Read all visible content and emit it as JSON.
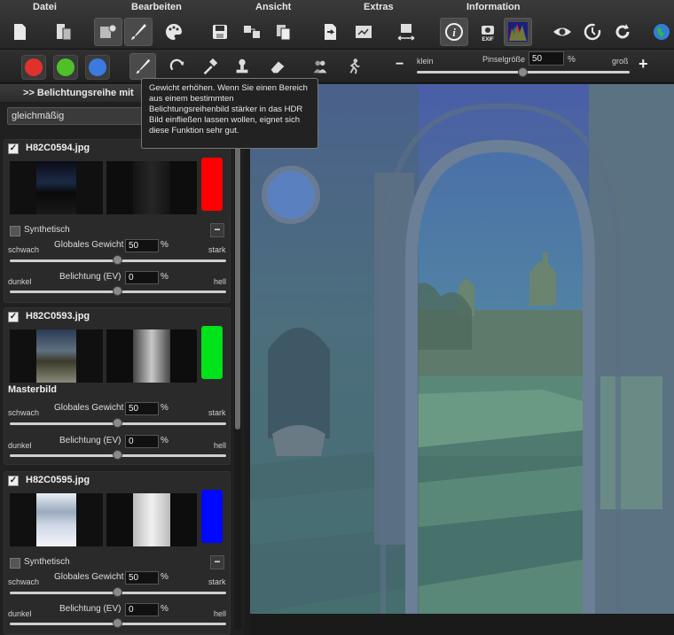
{
  "menu": {
    "datei": "Datei",
    "bearbeiten": "Bearbeiten",
    "ansicht": "Ansicht",
    "extras": "Extras",
    "information": "Information"
  },
  "toolbar_icons": [
    "new-document-icon",
    "open-document-icon",
    "settings-icon",
    "brush-icon",
    "palette-icon",
    "save-icon",
    "export-icon",
    "copy-icon",
    "send-icon",
    "batch-icon",
    "transform-icon",
    "info-icon",
    "exif-icon",
    "histogram-icon",
    "eye-icon",
    "history-icon",
    "redo-icon",
    "globe-icon"
  ],
  "exif_label": "EXIF",
  "colors": {
    "red": "#e0312d",
    "green": "#4ec12a",
    "blue": "#3b7be0",
    "accent_red": "#ff0000",
    "accent_green": "#00e21a",
    "accent_blue": "#0008ff"
  },
  "brush": {
    "klein": "klein",
    "size_label": "Pinselgröße",
    "size_value": "50",
    "percent": "%",
    "gross": "groß",
    "minus": "−",
    "plus": "+",
    "level": 0.5
  },
  "panel": {
    "title": ">> Belichtungsreihe mit",
    "mode": "gleichmäßig"
  },
  "tooltip": "Gewicht erhöhen. Wenn Sie einen Bereich aus einem bestimmten Belichtungsreihenbild stärker in das HDR Bild einfließen lassen wollen, eignet sich diese Funktion sehr gut.",
  "images": [
    {
      "name": "H82C0594.jpg",
      "checked": "✓",
      "synthetic": "Synthetisch",
      "master": "",
      "weight_label": "Globales Gewicht",
      "weight": "50",
      "weak": "schwach",
      "strong": "stark",
      "exposure_label": "Belichtung (EV)",
      "exposure": "0",
      "dark": "dunkel",
      "bright": "hell",
      "percent": "%"
    },
    {
      "name": "H82C0593.jpg",
      "checked": "✓",
      "synthetic": "",
      "master": "Masterbild",
      "weight_label": "Globales Gewicht",
      "weight": "50",
      "weak": "schwach",
      "strong": "stark",
      "exposure_label": "Belichtung (EV)",
      "exposure": "0",
      "dark": "dunkel",
      "bright": "hell",
      "percent": "%"
    },
    {
      "name": "H82C0595.jpg",
      "checked": "✓",
      "synthetic": "Synthetisch",
      "master": "",
      "weight_label": "Globales Gewicht",
      "weight": "50",
      "weak": "schwach",
      "strong": "stark",
      "exposure_label": "Belichtung (EV)",
      "exposure": "0",
      "dark": "dunkel",
      "bright": "hell",
      "percent": "%"
    }
  ]
}
